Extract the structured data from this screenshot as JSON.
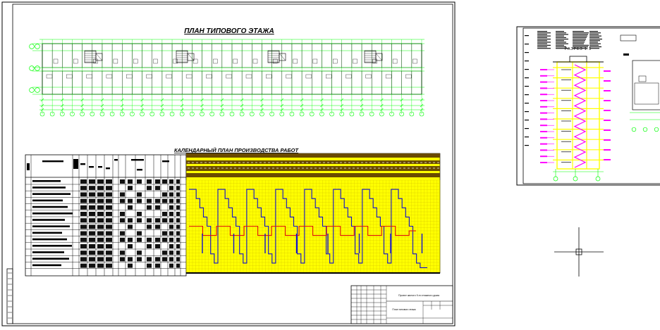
{
  "sheet1": {
    "plan_title": "ПЛАН ТИПОВОГО ЭТАЖА",
    "schedule_title": "КАЛЕНДАРНЫЙ ПЛАН ПРОИЗВОДСТВА РАБОТ",
    "stamp_text_1": "Проект жилого 9-ти этажного дома",
    "stamp_text_2": "План типового этажа"
  },
  "sheet2": {
    "section_title": "РАЗРЕЗ 1-1"
  },
  "colors": {
    "green": "#00ff00",
    "yellow": "#ffff00",
    "gridline": "#d8c800",
    "blue": "#1010d0",
    "red": "#e01010",
    "magenta": "#ff00ff",
    "frame": "#000000",
    "band": "#6a4a00",
    "cursor": "#000000"
  },
  "chart_data": {
    "type": "line",
    "series": [
      {
        "values": [
          9,
          9,
          8,
          7,
          6,
          5,
          2,
          1,
          9,
          9,
          8,
          7,
          6,
          5,
          2,
          1,
          9,
          9,
          8,
          7,
          6,
          5,
          2,
          1,
          9,
          9,
          8,
          7,
          6,
          5,
          2,
          1,
          9,
          9,
          8,
          7,
          6,
          5,
          2,
          1,
          9,
          9,
          8,
          7,
          6,
          5,
          2,
          1,
          9,
          9,
          8,
          7,
          6,
          5,
          2,
          1,
          9,
          9,
          8,
          7,
          6,
          5,
          2,
          1,
          0.5,
          0.5
        ]
      },
      {
        "values": [
          5,
          5,
          4,
          4,
          5,
          5,
          4,
          4,
          5,
          5,
          4,
          4,
          5,
          5,
          4,
          4,
          5,
          5,
          4,
          4,
          5,
          5,
          4,
          4,
          5,
          5,
          4,
          4,
          5,
          5,
          4,
          4,
          4.5
        ]
      }
    ],
    "ylim": [
      0,
      10
    ],
    "grid": true
  }
}
